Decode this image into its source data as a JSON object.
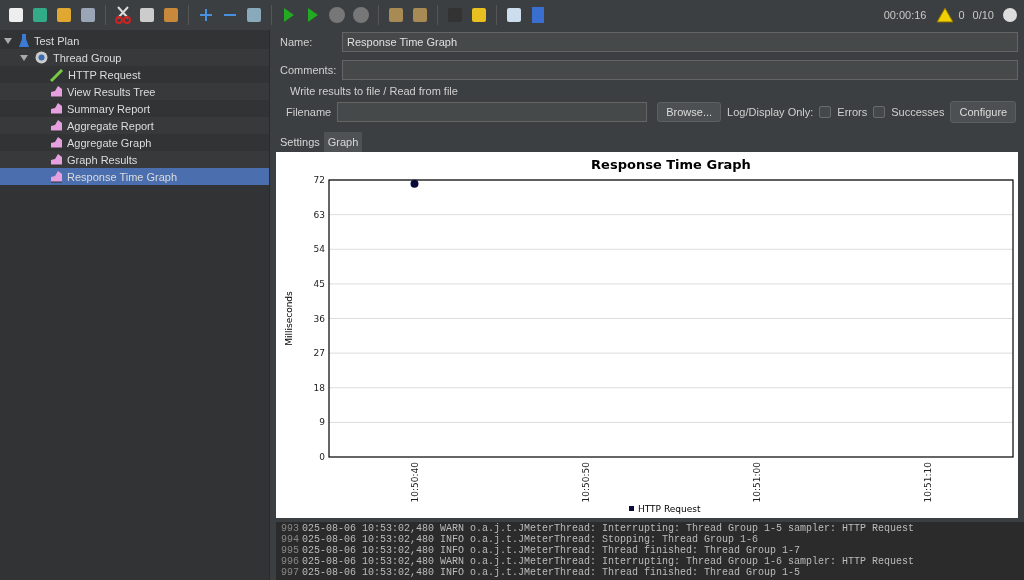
{
  "toolbar": {
    "timer": "00:00:16",
    "warnings": "0",
    "threads": "0/10"
  },
  "tree": [
    {
      "label": "Test Plan",
      "kind": "plan",
      "expanded": true,
      "selected": false,
      "children": [
        {
          "label": "Thread Group",
          "kind": "group",
          "expanded": true,
          "selected": false,
          "children": [
            {
              "label": "HTTP Request",
              "kind": "sampler",
              "selected": false
            },
            {
              "label": "View Results Tree",
              "kind": "listener",
              "selected": false
            },
            {
              "label": "Summary Report",
              "kind": "listener",
              "selected": false
            },
            {
              "label": "Aggregate Report",
              "kind": "listener",
              "selected": false
            },
            {
              "label": "Aggregate Graph",
              "kind": "listener",
              "selected": false
            },
            {
              "label": "Graph Results",
              "kind": "listener",
              "selected": false
            },
            {
              "label": "Response Time Graph",
              "kind": "listener",
              "selected": true
            }
          ]
        }
      ]
    }
  ],
  "form": {
    "name_label": "Name:",
    "name_value": "Response Time Graph",
    "comments_label": "Comments:",
    "group_title": "Write results to file / Read from file",
    "filename_label": "Filename",
    "browse": "Browse...",
    "log_label": "Log/Display Only:",
    "checks": [
      {
        "label": "Errors",
        "checked": false
      },
      {
        "label": "Successes",
        "checked": false
      }
    ],
    "configure": "Configure"
  },
  "tabs": [
    {
      "label": "Settings",
      "selected": false
    },
    {
      "label": "Graph",
      "selected": true
    }
  ],
  "chart_data": {
    "type": "scatter",
    "title": "Response Time Graph",
    "ylabel": "Milliseconds",
    "categories": [
      "10:50:40",
      "10:50:50",
      "10:51:00",
      "10:51:10"
    ],
    "series": [
      {
        "name": "HTTP Request",
        "color": "#0b0b3b",
        "values": [
          71,
          null,
          null,
          null
        ]
      }
    ],
    "ylim": [
      0,
      72
    ],
    "grid": true,
    "yticks": [
      0,
      9,
      18,
      27,
      36,
      45,
      54,
      63,
      72
    ]
  },
  "log": [
    {
      "line": "993",
      "text": "025-08-06 10:53:02,480 WARN o.a.j.t.JMeterThread: Interrupting: Thread Group 1-5 sampler: HTTP Request"
    },
    {
      "line": "994",
      "text": "025-08-06 10:53:02,480 INFO o.a.j.t.JMeterThread: Stopping: Thread Group 1-6"
    },
    {
      "line": "995",
      "text": "025-08-06 10:53:02,480 INFO o.a.j.t.JMeterThread: Thread finished: Thread Group 1-7"
    },
    {
      "line": "996",
      "text": "025-08-06 10:53:02,480 WARN o.a.j.t.JMeterThread: Interrupting: Thread Group 1-6 sampler: HTTP Request"
    },
    {
      "line": "997",
      "text": "025-08-06 10:53:02,480 INFO o.a.j.t.JMeterThread: Thread finished: Thread Group 1-5"
    }
  ]
}
